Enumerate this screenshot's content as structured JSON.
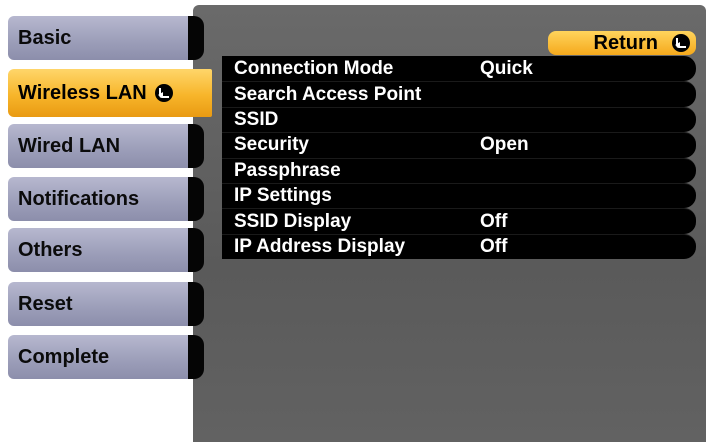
{
  "sidebar": {
    "tabs": [
      {
        "label": "Basic",
        "active": false
      },
      {
        "label": "Wireless LAN",
        "active": true
      },
      {
        "label": "Wired LAN",
        "active": false
      },
      {
        "label": "Notifications",
        "active": false
      },
      {
        "label": "Others",
        "active": false
      },
      {
        "label": "Reset",
        "active": false
      },
      {
        "label": "Complete",
        "active": false
      }
    ]
  },
  "return_button": {
    "label": "Return"
  },
  "menu": {
    "rows": [
      {
        "label": "Connection Mode",
        "value": "Quick"
      },
      {
        "label": "Search Access Point",
        "value": ""
      },
      {
        "label": "SSID",
        "value": ""
      },
      {
        "label": "Security",
        "value": "Open"
      },
      {
        "label": "Passphrase",
        "value": ""
      },
      {
        "label": "IP Settings",
        "value": ""
      },
      {
        "label": "SSID Display",
        "value": "Off"
      },
      {
        "label": "IP Address Display",
        "value": "Off"
      }
    ]
  },
  "colors": {
    "active_tab": "#f7b52a",
    "inactive_tab": "#9d9fba",
    "panel": "#5f5f5f",
    "row": "#000000",
    "text_on_row": "#ffffff"
  },
  "icons": {
    "enter": "enter-icon"
  }
}
